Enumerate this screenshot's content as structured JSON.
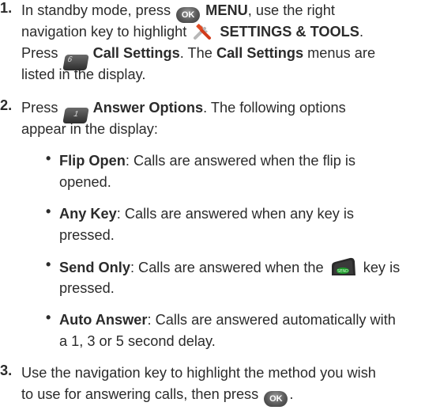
{
  "steps": [
    {
      "number": "1.",
      "lines": [
        [
          "In standby mode, press ",
          "MENU",
          ", use the right"
        ],
        [
          "navigation key to highlight ",
          "SETTINGS & TOOLS",
          "."
        ],
        [
          "Press ",
          "Call Settings",
          ". The ",
          "Call Settings",
          " menus are"
        ],
        [
          "listed in the display."
        ]
      ]
    },
    {
      "number": "2.",
      "lines": [
        [
          "Press ",
          "Answer Options",
          ". The following options"
        ],
        [
          "appear in the display:"
        ]
      ],
      "options": [
        {
          "name": "Flip Open",
          "text1": ": Calls are answered when the flip is",
          "text2": "opened."
        },
        {
          "name": "Any Key",
          "text1": ": Calls are answered when any key is",
          "text2": "pressed."
        },
        {
          "name": "Send Only",
          "text1": ": Calls are answered when the",
          "text1b": " key is",
          "text2": "pressed."
        },
        {
          "name": "Auto Answer",
          "text1": ": Calls are answered automatically with",
          "text2": "a 1, 3 or 5 second delay."
        }
      ]
    },
    {
      "number": "3.",
      "lines": [
        [
          "Use the navigation key to highlight the method you wish"
        ],
        [
          "to use for answering calls, then press"
        ]
      ]
    }
  ],
  "icons": {
    "ok_label": "OK",
    "key6_label": "6",
    "key1_label": "1"
  },
  "bullet_char": "•"
}
